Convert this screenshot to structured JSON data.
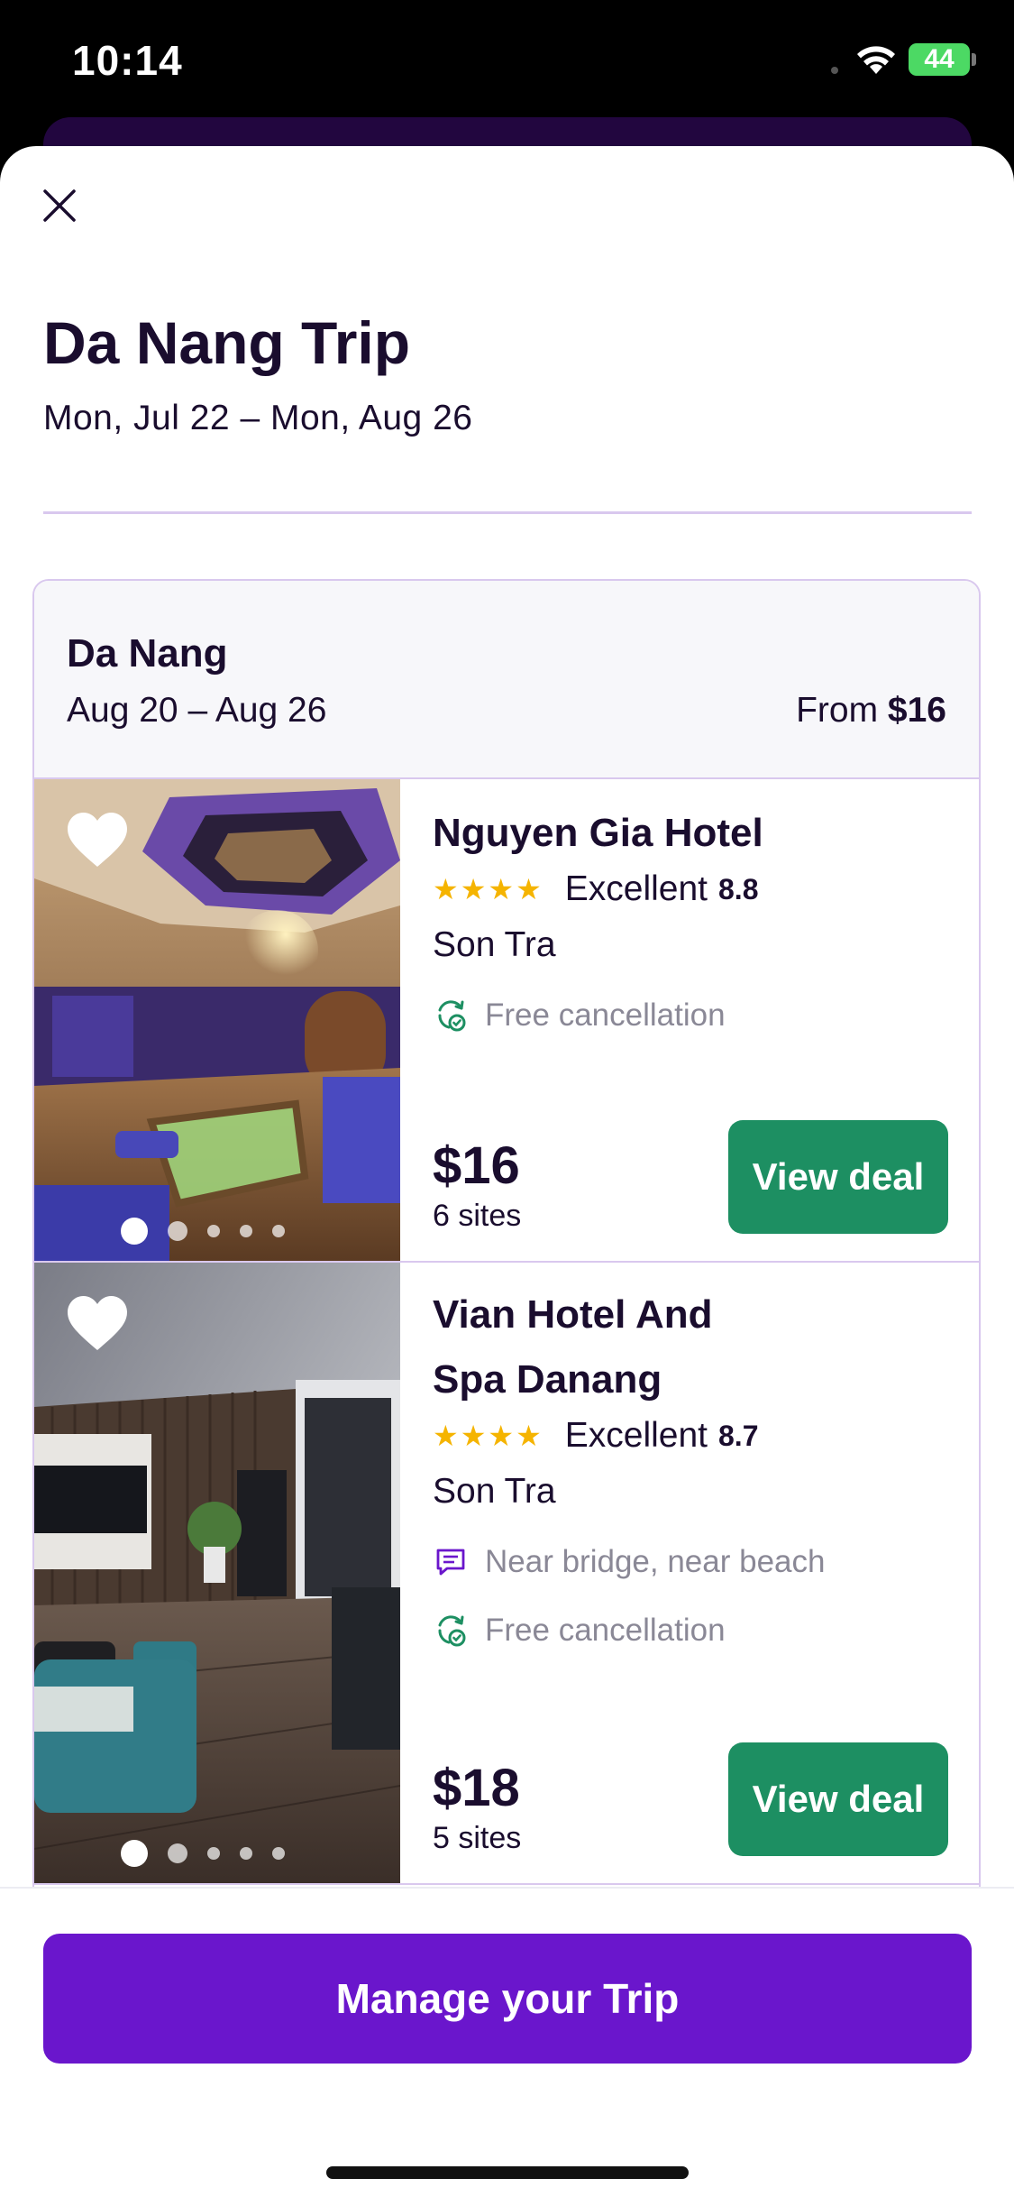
{
  "status_bar": {
    "time": "10:14",
    "battery": "44"
  },
  "trip": {
    "title": "Da Nang Trip",
    "dates": "Mon, Jul 22 – Mon, Aug 26"
  },
  "destination": {
    "name": "Da Nang",
    "dates": "Aug 20 – Aug 26",
    "price_prefix": "From",
    "price": "$16"
  },
  "hotels": [
    {
      "name": "Nguyen Gia Hotel",
      "stars": "★★★★",
      "rating_label": "Excellent",
      "rating_score": "8.8",
      "location": "Son Tra",
      "features": [
        "Free cancellation"
      ],
      "price": "$16",
      "sites": "6 sites",
      "cta": "View deal",
      "photo_count": 5
    },
    {
      "name": "Vian Hotel And Spa Danang",
      "stars": "★★★★",
      "rating_label": "Excellent",
      "rating_score": "8.7",
      "location": "Son Tra",
      "features": [
        "Near bridge, near beach",
        "Free cancellation"
      ],
      "price": "$18",
      "sites": "5 sites",
      "cta": "View deal",
      "photo_count": 5
    }
  ],
  "footer": {
    "manage_label": "Manage your Trip"
  },
  "colors": {
    "brand_purple": "#6a16cc",
    "deal_green": "#1d8f62",
    "star_yellow": "#f5b400",
    "text_dark": "#1a0d2e",
    "muted_text": "#8a8896"
  },
  "icons": [
    "wifi-icon",
    "battery-icon",
    "close-icon",
    "heart-icon",
    "star-icon",
    "free-cancellation-icon",
    "review-comment-icon"
  ]
}
